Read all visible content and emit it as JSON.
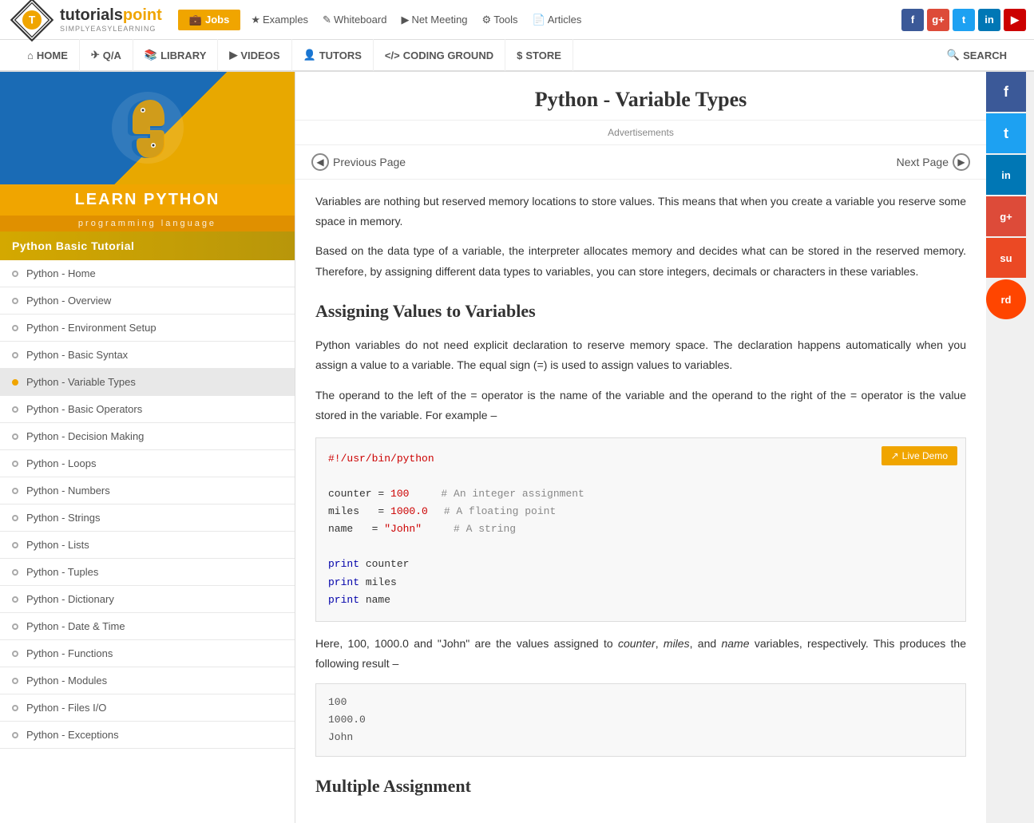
{
  "site": {
    "logo_tutorials": "tutorials",
    "logo_point": "point",
    "logo_sub": "SIMPLYEASYLEARNING"
  },
  "top_nav": {
    "jobs_label": "Jobs",
    "links": [
      {
        "label": "Examples",
        "icon": "★"
      },
      {
        "label": "Whiteboard",
        "icon": "✎"
      },
      {
        "label": "Net Meeting",
        "icon": "▶"
      },
      {
        "label": "Tools",
        "icon": "⚙"
      },
      {
        "label": "Articles",
        "icon": "📄"
      }
    ]
  },
  "main_nav": {
    "items": [
      {
        "label": "HOME",
        "icon": "⌂"
      },
      {
        "label": "Q/A",
        "icon": "✈"
      },
      {
        "label": "LIBRARY",
        "icon": "📚"
      },
      {
        "label": "VIDEOS",
        "icon": "▶"
      },
      {
        "label": "TUTORS",
        "icon": "👤"
      },
      {
        "label": "CODING GROUND",
        "icon": "</>"
      },
      {
        "label": "STORE",
        "icon": "$"
      },
      {
        "label": "Search",
        "icon": "🔍"
      }
    ]
  },
  "sidebar": {
    "learn_label": "LEARN PYTHON",
    "sub_label": "programming language",
    "section_label": "Python Basic Tutorial",
    "nav_items": [
      {
        "label": "Python - Home",
        "active": false
      },
      {
        "label": "Python - Overview",
        "active": false
      },
      {
        "label": "Python - Environment Setup",
        "active": false
      },
      {
        "label": "Python - Basic Syntax",
        "active": false
      },
      {
        "label": "Python - Variable Types",
        "active": true
      },
      {
        "label": "Python - Basic Operators",
        "active": false
      },
      {
        "label": "Python - Decision Making",
        "active": false
      },
      {
        "label": "Python - Loops",
        "active": false
      },
      {
        "label": "Python - Numbers",
        "active": false
      },
      {
        "label": "Python - Strings",
        "active": false
      },
      {
        "label": "Python - Lists",
        "active": false
      },
      {
        "label": "Python - Tuples",
        "active": false
      },
      {
        "label": "Python - Dictionary",
        "active": false
      },
      {
        "label": "Python - Date & Time",
        "active": false
      },
      {
        "label": "Python - Functions",
        "active": false
      },
      {
        "label": "Python - Modules",
        "active": false
      },
      {
        "label": "Python - Files I/O",
        "active": false
      },
      {
        "label": "Python - Exceptions",
        "active": false
      }
    ]
  },
  "content": {
    "title": "Python - Variable Types",
    "ads_label": "Advertisements",
    "prev_label": "Previous Page",
    "next_label": "Next Page",
    "intro_p1": "Variables are nothing but reserved memory locations to store values. This means that when you create a variable you reserve some space in memory.",
    "intro_p2": "Based on the data type of a variable, the interpreter allocates memory and decides what can be stored in the reserved memory. Therefore, by assigning different data types to variables, you can store integers, decimals or characters in these variables.",
    "section1_title": "Assigning Values to Variables",
    "section1_p1": "Python variables do not need explicit declaration to reserve memory space. The declaration happens automatically when you assign a value to a variable. The equal sign (=) is used to assign values to variables.",
    "section1_p2": "The operand to the left of the = operator is the name of the variable and the operand to the right of the = operator is the value stored in the variable. For example –",
    "live_demo_label": "Live Demo",
    "code_shebang": "#!/usr/bin/python",
    "code_line1_var": "counter",
    "code_line1_val": "100",
    "code_line1_comment": "# An integer assignment",
    "code_line2_var": "miles  ",
    "code_line2_val": "1000.0",
    "code_line2_comment": "# A floating point",
    "code_line3_var": "name  ",
    "code_line3_val": "\"John\"",
    "code_line3_comment": "# A string",
    "code_print1": "print counter",
    "code_print2": "print miles",
    "code_print3": "print name",
    "result_p": "Here, 100, 1000.0 and \"John\" are the values assigned to counter, miles, and name variables, respectively. This produces the following result –",
    "output_line1": "100",
    "output_line2": "1000.0",
    "output_line3": "John",
    "section2_title": "Multiple Assignment"
  },
  "social_right": {
    "buttons": [
      {
        "label": "f",
        "color": "#3b5998"
      },
      {
        "label": "t",
        "color": "#1da1f2"
      },
      {
        "label": "in",
        "color": "#0077b5"
      },
      {
        "label": "g+",
        "color": "#dd4b39"
      },
      {
        "label": "su",
        "color": "#eb4924"
      },
      {
        "label": "rd",
        "color": "#ff4500"
      }
    ]
  },
  "social_top": {
    "buttons": [
      {
        "label": "f",
        "color": "#3b5998"
      },
      {
        "label": "g+",
        "color": "#dd4b39"
      },
      {
        "label": "t",
        "color": "#1da1f2"
      },
      {
        "label": "in",
        "color": "#0077b5"
      },
      {
        "label": "yt",
        "color": "#cc0000"
      }
    ]
  }
}
